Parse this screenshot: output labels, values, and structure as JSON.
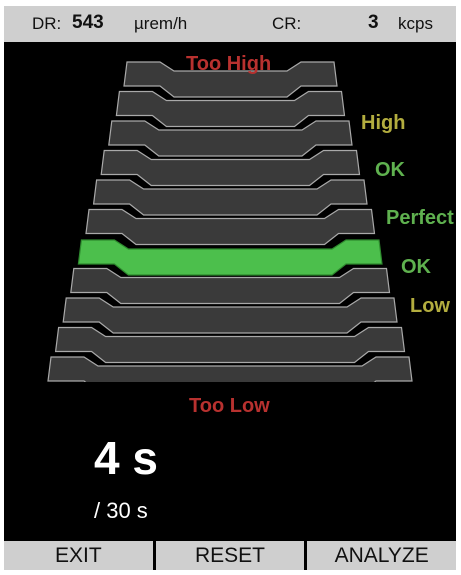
{
  "status": {
    "dr_label": "DR:",
    "dr_value": "543",
    "dr_unit": "µrem/h",
    "cr_label": "CR:",
    "cr_value": "3",
    "cr_unit": "kcps"
  },
  "meter": {
    "rows": 11,
    "active_row_index": 6,
    "colors": {
      "row": "#3a3a3a",
      "row_edge": "#a9a9a9",
      "active": "#4cbf4c",
      "too": "#b8312f",
      "warn": "#b3ad3f",
      "good": "#5fb14f"
    },
    "labels": {
      "too_high": "Too High",
      "high": "High",
      "ok_upper": "OK",
      "perfect": "Perfect",
      "ok_lower": "OK",
      "low": "Low",
      "too_low": "Too Low"
    }
  },
  "timer": {
    "elapsed": "4 s",
    "total": "/ 30 s"
  },
  "softkeys": {
    "exit": "EXIT",
    "reset": "RESET",
    "analyze": "ANALYZE"
  }
}
